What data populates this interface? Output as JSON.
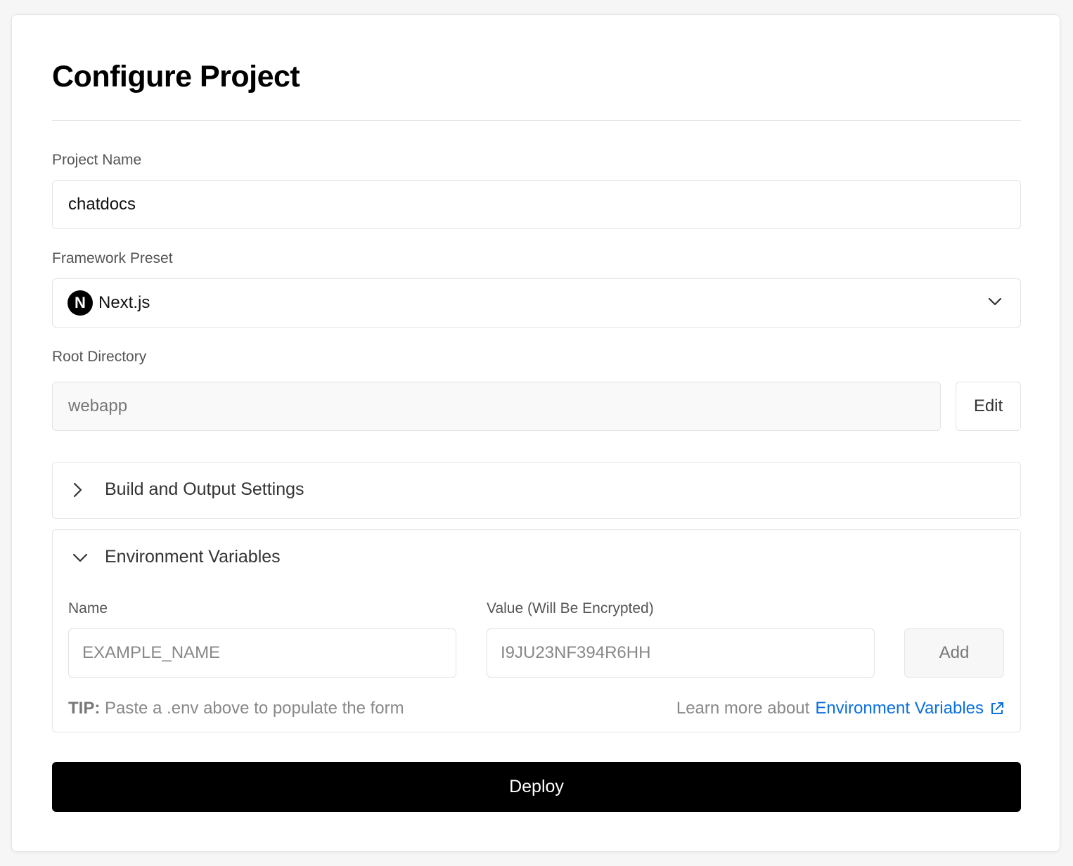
{
  "page": {
    "title": "Configure Project"
  },
  "project_name": {
    "label": "Project Name",
    "value": "chatdocs"
  },
  "framework": {
    "label": "Framework Preset",
    "value": "Next.js",
    "icon": "nextjs-logo-icon"
  },
  "root_directory": {
    "label": "Root Directory",
    "value": "webapp",
    "edit_label": "Edit"
  },
  "build_settings": {
    "label": "Build and Output Settings",
    "expanded": false
  },
  "env_vars": {
    "label": "Environment Variables",
    "expanded": true,
    "name_label": "Name",
    "name_placeholder": "EXAMPLE_NAME",
    "value_label": "Value (Will Be Encrypted)",
    "value_placeholder": "I9JU23NF394R6HH",
    "add_label": "Add",
    "tip_bold": "TIP:",
    "tip_text": "Paste a .env above to populate the form",
    "learn_prefix": "Learn more about",
    "learn_link": "Environment Variables"
  },
  "deploy": {
    "label": "Deploy"
  },
  "colors": {
    "link": "#0b6fde",
    "deploy_bg": "#000000"
  }
}
